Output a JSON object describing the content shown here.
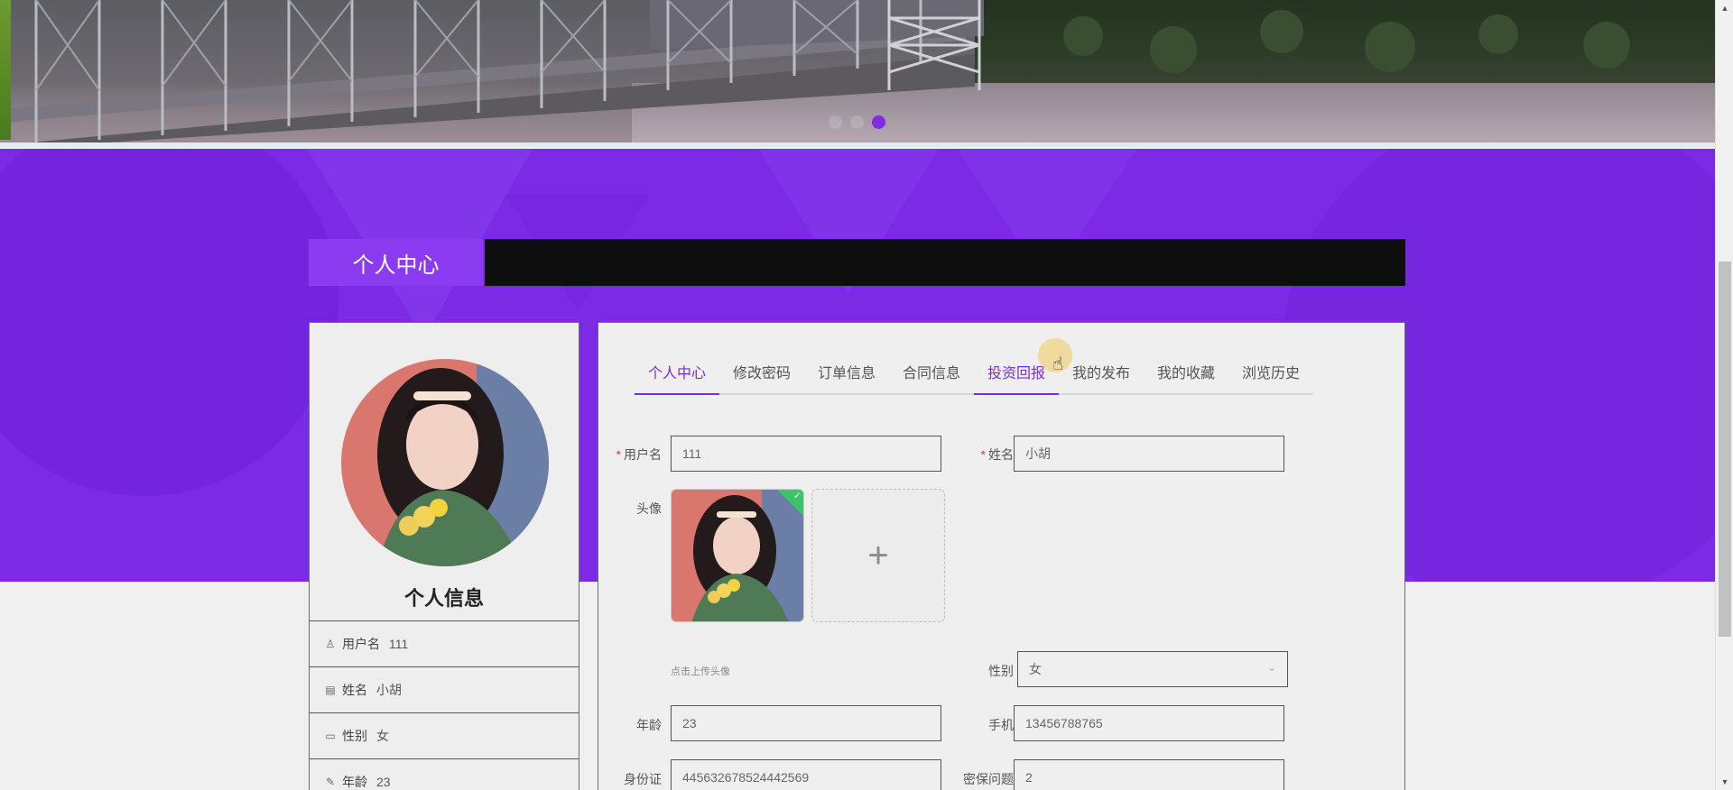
{
  "banner": {
    "dots": [
      {
        "active": false
      },
      {
        "active": false
      },
      {
        "active": true
      }
    ]
  },
  "section": {
    "title": "个人中心"
  },
  "profile": {
    "heading": "个人信息",
    "rows": [
      {
        "icon": "user-icon",
        "label": "用户名",
        "value": "111"
      },
      {
        "icon": "id-card-icon",
        "label": "姓名",
        "value": "小胡"
      },
      {
        "icon": "message-icon",
        "label": "性别",
        "value": "女"
      },
      {
        "icon": "edit-icon",
        "label": "年龄",
        "value": "23"
      }
    ]
  },
  "tabs": [
    {
      "label": "个人中心",
      "active": true
    },
    {
      "label": "修改密码"
    },
    {
      "label": "订单信息"
    },
    {
      "label": "合同信息"
    },
    {
      "label": "投资回报",
      "hover": true
    },
    {
      "label": "我的发布"
    },
    {
      "label": "我的收藏"
    },
    {
      "label": "浏览历史"
    }
  ],
  "form": {
    "username": {
      "label": "用户名",
      "value": "111",
      "required": true
    },
    "name": {
      "label": "姓名",
      "value": "小胡",
      "required": true
    },
    "avatar": {
      "label": "头像",
      "hint": "点击上传头像"
    },
    "gender": {
      "label": "性别",
      "value": "女"
    },
    "age": {
      "label": "年龄",
      "value": "23"
    },
    "phone": {
      "label": "手机",
      "value": "13456788765"
    },
    "idcard": {
      "label": "身份证",
      "value": "445632678524442569"
    },
    "security_question": {
      "label": "密保问题",
      "value": "2"
    }
  },
  "colors": {
    "accent": "#7c2ae6",
    "title_bar": "#0e0e0e",
    "required": "#ee3344"
  }
}
